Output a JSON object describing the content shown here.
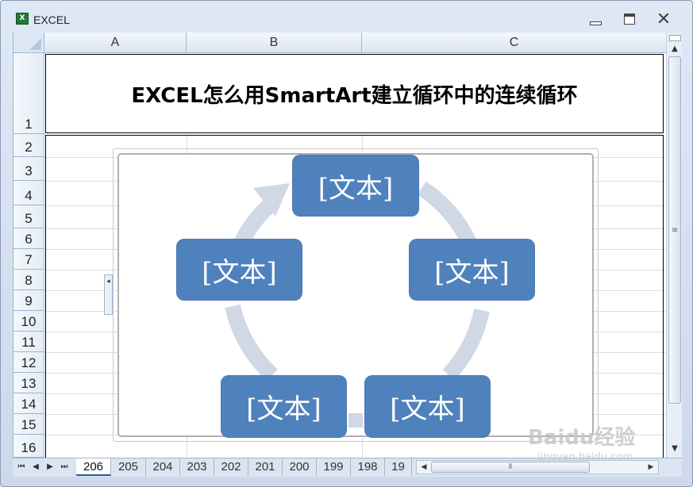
{
  "window": {
    "title": "EXCEL",
    "icon": "excel-icon",
    "minimize_icon": "minimize-icon",
    "maximize_icon": "restore-icon",
    "close_icon": "close-icon"
  },
  "sheet": {
    "columns": [
      "A",
      "B",
      "C"
    ],
    "rows": [
      "1",
      "2",
      "3",
      "4",
      "5",
      "6",
      "7",
      "8",
      "9",
      "10",
      "11",
      "12",
      "13",
      "14",
      "15",
      "16"
    ],
    "cell_a1": "EXCEL怎么用SmartArt建立循环中的连续循环"
  },
  "smartart": {
    "type": "cycle",
    "arrow_color": "#d0d7e5",
    "node_color": "#4f81bd",
    "nodes": [
      "[文本]",
      "[文本]",
      "[文本]",
      "[文本]",
      "[文本]"
    ],
    "expand_tab_glyph": "◂"
  },
  "tabs": {
    "items": [
      "206",
      "205",
      "204",
      "203",
      "202",
      "201",
      "200",
      "199",
      "198",
      "19"
    ],
    "active": "206"
  },
  "watermark": {
    "brand": "Baidu经验",
    "url": "jingyan.baidu.com"
  }
}
